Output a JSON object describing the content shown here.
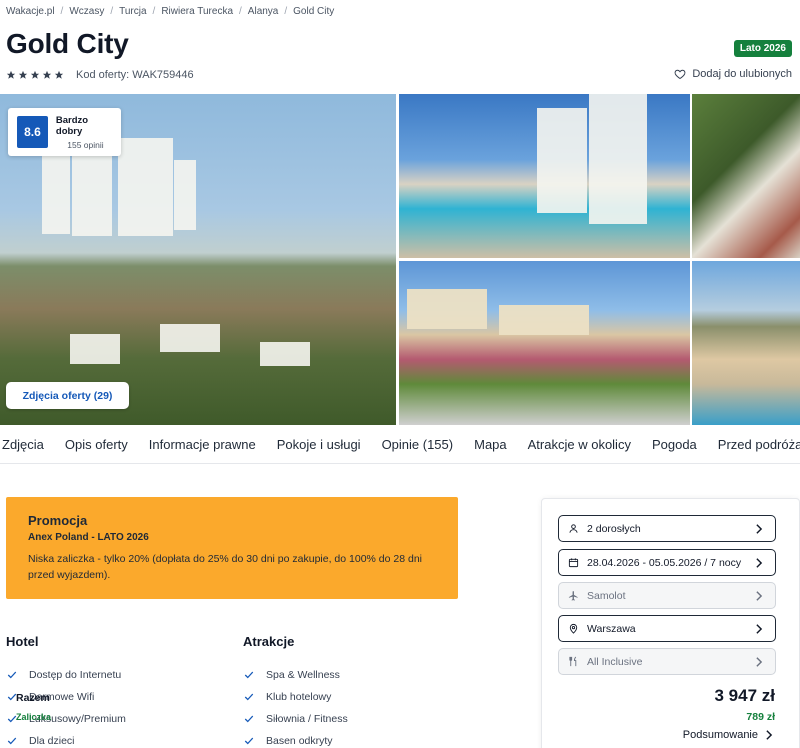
{
  "breadcrumb": [
    "Wakacje.pl",
    "Wczasy",
    "Turcja",
    "Riwiera Turecka",
    "Alanya",
    "Gold City"
  ],
  "hotel": {
    "name": "Gold City",
    "season_badge": "Lato 2026",
    "stars": 5,
    "offer_code": "Kod oferty: WAK759446",
    "favorite_label": "Dodaj do ulubionych"
  },
  "rating": {
    "score": "8.6",
    "label": "Bardzo dobry",
    "count": "155 opinii"
  },
  "gallery": {
    "photos_button": "Zdjęcia oferty (29)"
  },
  "tabs": [
    "Zdjęcia",
    "Opis oferty",
    "Informacje prawne",
    "Pokoje i usługi",
    "Opinie (155)",
    "Mapa",
    "Atrakcje w okolicy",
    "Pogoda",
    "Przed podróżą"
  ],
  "promo": {
    "title": "Promocja",
    "subtitle": "Anex Poland - LATO 2026",
    "text": "Niska zaliczka - tylko 20% (dopłata do 25% do 30 dni po zakupie, do 100% do 28 dni przed wyjazdem)."
  },
  "features": {
    "hotel": {
      "heading": "Hotel",
      "items": [
        "Dostęp do Internetu",
        "Darmowe Wifi",
        "Luksusowy/Premium",
        "Dla dzieci"
      ]
    },
    "attractions": {
      "heading": "Atrakcje",
      "items": [
        "Spa & Wellness",
        "Klub hotelowy",
        "Siłownia / Fitness",
        "Basen odkryty"
      ]
    }
  },
  "booking": {
    "travelers": "2 dorosłych",
    "dates": "28.04.2026 - 05.05.2026 / 7 nocy",
    "transport": "Samolot",
    "departure": "Warszawa",
    "board": "All Inclusive",
    "total_label": "Razem",
    "total_price": "3 947 zł",
    "deposit_label": "Zaliczka",
    "deposit_price": "789 zł",
    "summary_label": "Podsumowanie"
  },
  "colors": {
    "brand_blue": "#1559b8",
    "promo_orange": "#fba92c",
    "success_green": "#15803d"
  }
}
